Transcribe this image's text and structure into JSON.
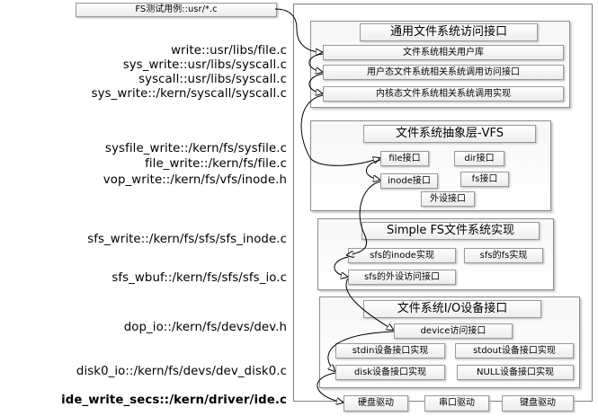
{
  "top_box": "FS测试用例::usr/*.c",
  "functions": [
    "write::usr/libs/file.c",
    "sys_write::usr/libs/syscall.c",
    "syscall::usr/libs/syscall.c",
    "sys_write::/kern/syscall/syscall.c",
    "sysfile_write::/kern/fs/sysfile.c",
    "file_write::/kern/fs/file.c",
    "vop_write::/kern/fs/vfs/inode.h",
    "sfs_write::/kern/fs/sfs/sfs_inode.c",
    "sfs_wbuf::/kern/fs/sfs/sfs_io.c",
    "dop_io::/kern/fs/devs/dev.h",
    "disk0_io::/kern/fs/devs/dev_disk0.c",
    "ide_write_secs::/kern/driver/ide.c"
  ],
  "layers": {
    "generic": {
      "title": "通用文件系统访问接口",
      "items": [
        "文件系统相关用户库",
        "用户态文件系统相关系统调用访问接口",
        "内核态文件系统相关系统调用实现"
      ]
    },
    "vfs": {
      "title": "文件系统抽象层-VFS",
      "file": "file接口",
      "dir": "dir接口",
      "inode": "inode接口",
      "fs": "fs接口",
      "device": "外设接口"
    },
    "sfs": {
      "title": "Simple FS文件系统实现",
      "inode": "sfs的inode实现",
      "fs": "sfs的fs实现",
      "device": "sfs的外设访问接口"
    },
    "io": {
      "title": "文件系统I/O设备接口",
      "device": "device访问接口",
      "stdin": "stdin设备接口实现",
      "stdout": "stdout设备接口实现",
      "disk": "disk设备接口实现",
      "null": "NULL设备接口实现"
    }
  },
  "drivers": [
    "硬盘驱动",
    "串口驱动",
    "键盘驱动"
  ]
}
